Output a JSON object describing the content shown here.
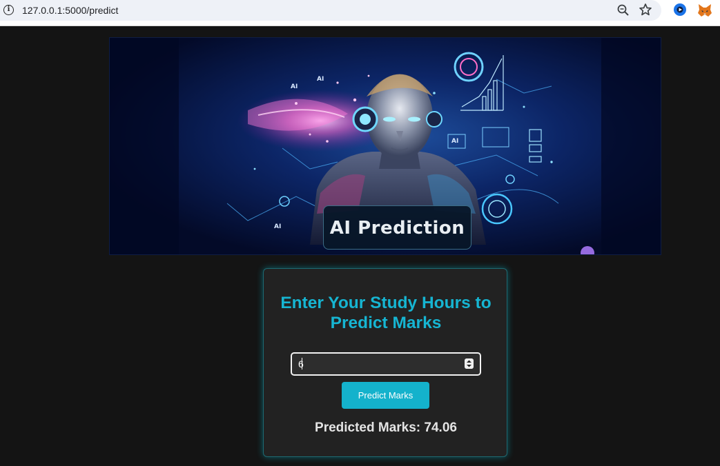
{
  "browser": {
    "url": "127.0.0.1:5000/predict",
    "icons": [
      "info-icon",
      "zoom-icon",
      "bookmark-star-icon",
      "extension-icon",
      "metamask-fox-icon"
    ]
  },
  "hero": {
    "label": "AI Prediction",
    "small_text": [
      "AI",
      "AI",
      "AI",
      "AI"
    ]
  },
  "form": {
    "title": "Enter Your Study Hours to Predict Marks",
    "hours_value": "6",
    "button_label": "Predict Marks",
    "result_text": "Predicted Marks: 74.06"
  },
  "colors": {
    "page_background": "#141414",
    "card_background": "#222222",
    "accent": "#16b5d2",
    "button": "#14b2cc"
  }
}
